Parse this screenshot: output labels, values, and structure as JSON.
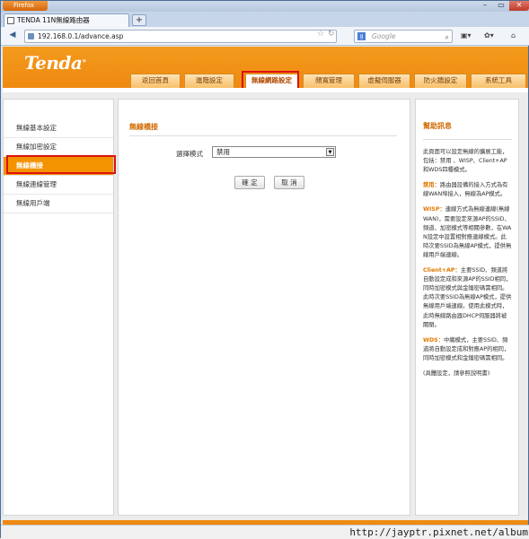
{
  "browser": {
    "app_button": "Firefox",
    "tab_title": "TENDA 11N無線路由器",
    "new_tab": "+",
    "url": "192.168.0.1/advance.asp",
    "search_engine": "Google",
    "window_controls": [
      "–",
      "▭",
      "✕"
    ]
  },
  "brand": {
    "logo": "Tenda",
    "accent": "#f39300"
  },
  "topnav": [
    {
      "label": "返回首頁"
    },
    {
      "label": "進階設定"
    },
    {
      "label": "無線網路設定"
    },
    {
      "label": "頻寬管理"
    },
    {
      "label": "虛擬伺服器"
    },
    {
      "label": "防火牆設定"
    },
    {
      "label": "系統工具"
    }
  ],
  "sidebar": [
    {
      "label": "無線基本設定"
    },
    {
      "label": "無線加密設定"
    },
    {
      "label": "無線橋接"
    },
    {
      "label": "無線連線管理"
    },
    {
      "label": "無線用戶端"
    }
  ],
  "main": {
    "section_title": "無線橋接",
    "mode_label": "選擇模式",
    "mode_value": "禁用",
    "confirm_button": "確 定",
    "cancel_button": "取 消"
  },
  "help": {
    "title": "幫助訊息",
    "p1": "此頁面可以設定無線的擴展工能，包括：禁用 、WISP、Client+AP和WDS四種模式。",
    "p2_key": "禁用：",
    "p2": "路由器設備的接入方式為有線WAN埠接入，無線為AP模式。",
    "p3_key": "WISP：",
    "p3": "連線方式為無線連線(無線WAN)，需要設定來源AP的SSID、頻道、加密模式等相關參數，在WAN設定中設置相對應連線模式。此時次要SSID為無線AP模式，提供無線用戶端連線。",
    "p4_key": "Client+AP：",
    "p4": "主要SSID、頻道將自動設定成和來源AP的SSID相同，同時加密模式與金鑰密碼需相同。此時次要SSID為無線AP模式，提供無線用戶端連線。使用此模式時，此時無線路由器DHCP伺服器將被關閉。",
    "p5_key": "WDS：",
    "p5": "中繼模式，主要SSID、頻道將自動設定成和對應AP的相同，同時加密模式和金鑰密碼需相同。",
    "p6": "(具體設定，請參照說明書)"
  },
  "watermark": "http://jayptr.pixnet.net/album"
}
